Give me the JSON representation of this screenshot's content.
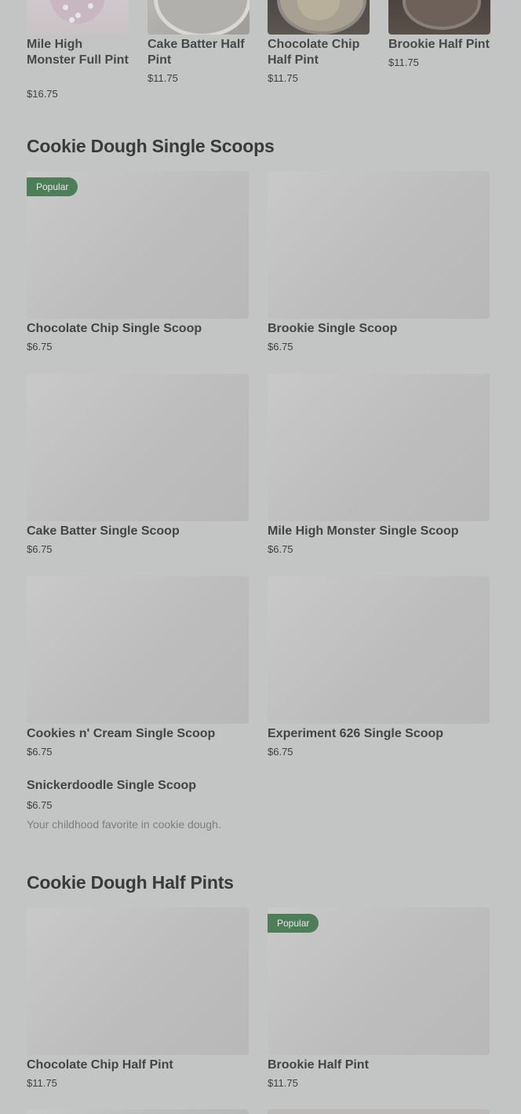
{
  "top_row": {
    "items": [
      {
        "name": "Mile High Monster Full Pint",
        "price": "$16.75"
      },
      {
        "name": "Cake Batter Half Pint",
        "price": "$11.75"
      },
      {
        "name": "Chocolate Chip Half Pint",
        "price": "$11.75"
      },
      {
        "name": "Brookie Half Pint",
        "price": "$11.75"
      }
    ]
  },
  "single_scoops": {
    "title": "Cookie Dough Single Scoops",
    "badge": "Popular",
    "items": [
      {
        "name": "Chocolate Chip Single Scoop",
        "price": "$6.75"
      },
      {
        "name": "Brookie Single Scoop",
        "price": "$6.75"
      },
      {
        "name": "Cake Batter Single Scoop",
        "price": "$6.75"
      },
      {
        "name": "Mile High Monster Single Scoop",
        "price": "$6.75"
      },
      {
        "name": "Cookies n' Cream Single Scoop",
        "price": "$6.75"
      },
      {
        "name": "Experiment 626 Single Scoop",
        "price": "$6.75"
      },
      {
        "name": "Snickerdoodle Single Scoop",
        "price": "$6.75",
        "description": "Your childhood favorite in cookie dough."
      }
    ]
  },
  "half_pints": {
    "title": "Cookie Dough Half Pints",
    "badge": "Popular",
    "items": [
      {
        "name": "Chocolate Chip Half Pint",
        "price": "$11.75"
      },
      {
        "name": "Brookie Half Pint",
        "price": "$11.75"
      }
    ]
  },
  "colors": {
    "overlay_background": "#c3c4c4",
    "badge_green": "#4d7d59"
  }
}
